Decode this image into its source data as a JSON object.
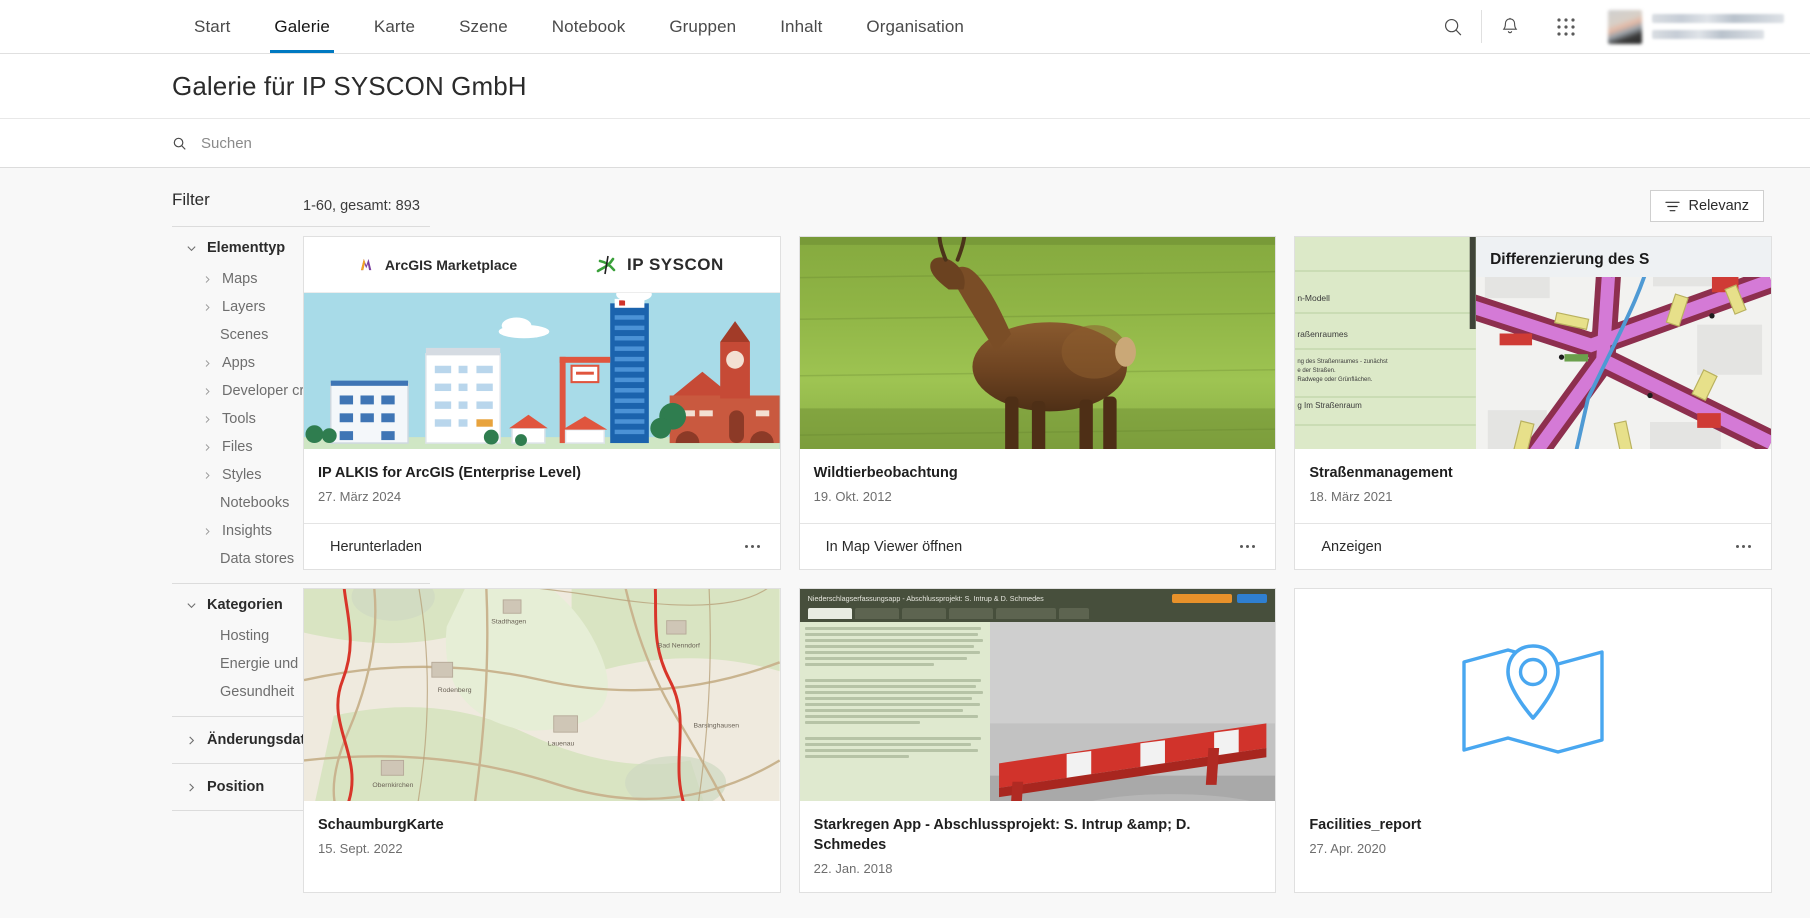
{
  "nav": {
    "items": [
      {
        "label": "Start",
        "active": false
      },
      {
        "label": "Galerie",
        "active": true
      },
      {
        "label": "Karte",
        "active": false
      },
      {
        "label": "Szene",
        "active": false
      },
      {
        "label": "Notebook",
        "active": false
      },
      {
        "label": "Gruppen",
        "active": false
      },
      {
        "label": "Inhalt",
        "active": false
      },
      {
        "label": "Organisation",
        "active": false
      }
    ],
    "search_icon": "search-icon",
    "notifications_icon": "bell-icon",
    "apps_icon": "grid-apps-icon",
    "avatar": "user-avatar",
    "user_name_redacted": "",
    "user_org_redacted": ""
  },
  "header": {
    "title": "Galerie für IP SYSCON GmbH"
  },
  "search": {
    "placeholder": "Suchen",
    "value": "",
    "icon": "search-icon"
  },
  "sidebar": {
    "title": "Filter",
    "facets": [
      {
        "title": "Elementtyp",
        "expanded": true,
        "items": [
          {
            "label": "Maps",
            "has_chevron": true
          },
          {
            "label": "Layers",
            "has_chevron": true
          },
          {
            "label": "Scenes",
            "has_chevron": false
          },
          {
            "label": "Apps",
            "has_chevron": true
          },
          {
            "label": "Developer credentials",
            "has_chevron": true
          },
          {
            "label": "Tools",
            "has_chevron": true
          },
          {
            "label": "Files",
            "has_chevron": true
          },
          {
            "label": "Styles",
            "has_chevron": true
          },
          {
            "label": "Notebooks",
            "has_chevron": false
          },
          {
            "label": "Insights",
            "has_chevron": true
          },
          {
            "label": "Data stores",
            "has_chevron": false
          }
        ]
      },
      {
        "title": "Kategorien",
        "expanded": true,
        "items": [
          {
            "label": "Hosting",
            "has_chevron": false
          },
          {
            "label": "Energie und Klima",
            "has_chevron": false
          },
          {
            "label": "Gesundheit",
            "has_chevron": false
          }
        ]
      },
      {
        "title": "Änderungsdatum",
        "expanded": false,
        "items": []
      },
      {
        "title": "Position",
        "expanded": false,
        "items": []
      }
    ]
  },
  "results": {
    "count_text": "1-60, gesamt: 893",
    "sort_label": "Relevanz",
    "sort_icon": "sort-icon",
    "cards": [
      {
        "title": "IP ALKIS for ArcGIS (Enterprise Level)",
        "date": "27. März 2024",
        "action": "Herunterladen",
        "menu_icon": "more-options-icon",
        "thumb_kind": "marketplace",
        "thumb_brand_left": "ArcGIS Marketplace",
        "thumb_brand_right": "IP SYSCON"
      },
      {
        "title": "Wildtierbeobachtung",
        "date": "19. Okt. 2012",
        "action": "In Map Viewer öffnen",
        "menu_icon": "more-options-icon",
        "thumb_kind": "deer-photo"
      },
      {
        "title": "Straßenmanagement",
        "date": "18. März 2021",
        "action": "Anzeigen",
        "menu_icon": "more-options-icon",
        "thumb_kind": "strassen",
        "thumb_heading": "Differenzierung des S",
        "thumb_left_lines": [
          "n-Modell",
          "raßenraumes",
          "ng des Straßenraumes - zunächst",
          "e der Straßen.",
          "Radwege oder Grünflächen.",
          "g Im Straßenraum"
        ]
      },
      {
        "title": "SchaumburgKarte",
        "date": "15. Sept. 2022",
        "action": "",
        "menu_icon": "more-options-icon",
        "thumb_kind": "topo-map"
      },
      {
        "title": "Starkregen App - Abschlussprojekt: S. Intrup &amp; D. Schmedes",
        "date": "22. Jan. 2018",
        "action": "",
        "menu_icon": "more-options-icon",
        "thumb_kind": "starkregen",
        "thumb_heading": "Niederschlagserfassungsapp - Abschlussprojekt: S. Intrup & D. Schmedes"
      },
      {
        "title": "Facilities_report",
        "date": "27. Apr. 2020",
        "action": "",
        "menu_icon": "more-options-icon",
        "thumb_kind": "map-pin-placeholder"
      }
    ]
  },
  "colors": {
    "accent": "#0079c1",
    "page_bg": "#f8f8f8",
    "card_bg": "#ffffff",
    "border": "#e0e0e0",
    "text": "#2b2b2b",
    "muted": "#6e6e6e",
    "placeholder_icon": "#49a7f0"
  }
}
